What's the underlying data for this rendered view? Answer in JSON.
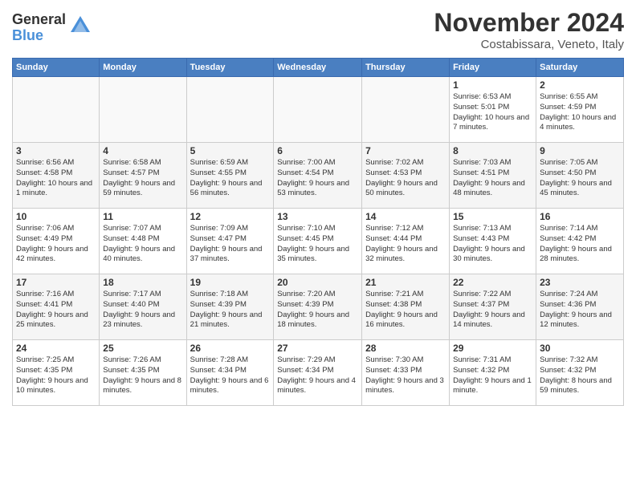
{
  "header": {
    "logo": {
      "general": "General",
      "blue": "Blue"
    },
    "title": "November 2024",
    "subtitle": "Costabissara, Veneto, Italy"
  },
  "calendar": {
    "days_of_week": [
      "Sunday",
      "Monday",
      "Tuesday",
      "Wednesday",
      "Thursday",
      "Friday",
      "Saturday"
    ],
    "weeks": [
      [
        {
          "day": "",
          "info": ""
        },
        {
          "day": "",
          "info": ""
        },
        {
          "day": "",
          "info": ""
        },
        {
          "day": "",
          "info": ""
        },
        {
          "day": "",
          "info": ""
        },
        {
          "day": "1",
          "info": "Sunrise: 6:53 AM\nSunset: 5:01 PM\nDaylight: 10 hours and 7 minutes."
        },
        {
          "day": "2",
          "info": "Sunrise: 6:55 AM\nSunset: 4:59 PM\nDaylight: 10 hours and 4 minutes."
        }
      ],
      [
        {
          "day": "3",
          "info": "Sunrise: 6:56 AM\nSunset: 4:58 PM\nDaylight: 10 hours and 1 minute."
        },
        {
          "day": "4",
          "info": "Sunrise: 6:58 AM\nSunset: 4:57 PM\nDaylight: 9 hours and 59 minutes."
        },
        {
          "day": "5",
          "info": "Sunrise: 6:59 AM\nSunset: 4:55 PM\nDaylight: 9 hours and 56 minutes."
        },
        {
          "day": "6",
          "info": "Sunrise: 7:00 AM\nSunset: 4:54 PM\nDaylight: 9 hours and 53 minutes."
        },
        {
          "day": "7",
          "info": "Sunrise: 7:02 AM\nSunset: 4:53 PM\nDaylight: 9 hours and 50 minutes."
        },
        {
          "day": "8",
          "info": "Sunrise: 7:03 AM\nSunset: 4:51 PM\nDaylight: 9 hours and 48 minutes."
        },
        {
          "day": "9",
          "info": "Sunrise: 7:05 AM\nSunset: 4:50 PM\nDaylight: 9 hours and 45 minutes."
        }
      ],
      [
        {
          "day": "10",
          "info": "Sunrise: 7:06 AM\nSunset: 4:49 PM\nDaylight: 9 hours and 42 minutes."
        },
        {
          "day": "11",
          "info": "Sunrise: 7:07 AM\nSunset: 4:48 PM\nDaylight: 9 hours and 40 minutes."
        },
        {
          "day": "12",
          "info": "Sunrise: 7:09 AM\nSunset: 4:47 PM\nDaylight: 9 hours and 37 minutes."
        },
        {
          "day": "13",
          "info": "Sunrise: 7:10 AM\nSunset: 4:45 PM\nDaylight: 9 hours and 35 minutes."
        },
        {
          "day": "14",
          "info": "Sunrise: 7:12 AM\nSunset: 4:44 PM\nDaylight: 9 hours and 32 minutes."
        },
        {
          "day": "15",
          "info": "Sunrise: 7:13 AM\nSunset: 4:43 PM\nDaylight: 9 hours and 30 minutes."
        },
        {
          "day": "16",
          "info": "Sunrise: 7:14 AM\nSunset: 4:42 PM\nDaylight: 9 hours and 28 minutes."
        }
      ],
      [
        {
          "day": "17",
          "info": "Sunrise: 7:16 AM\nSunset: 4:41 PM\nDaylight: 9 hours and 25 minutes."
        },
        {
          "day": "18",
          "info": "Sunrise: 7:17 AM\nSunset: 4:40 PM\nDaylight: 9 hours and 23 minutes."
        },
        {
          "day": "19",
          "info": "Sunrise: 7:18 AM\nSunset: 4:39 PM\nDaylight: 9 hours and 21 minutes."
        },
        {
          "day": "20",
          "info": "Sunrise: 7:20 AM\nSunset: 4:39 PM\nDaylight: 9 hours and 18 minutes."
        },
        {
          "day": "21",
          "info": "Sunrise: 7:21 AM\nSunset: 4:38 PM\nDaylight: 9 hours and 16 minutes."
        },
        {
          "day": "22",
          "info": "Sunrise: 7:22 AM\nSunset: 4:37 PM\nDaylight: 9 hours and 14 minutes."
        },
        {
          "day": "23",
          "info": "Sunrise: 7:24 AM\nSunset: 4:36 PM\nDaylight: 9 hours and 12 minutes."
        }
      ],
      [
        {
          "day": "24",
          "info": "Sunrise: 7:25 AM\nSunset: 4:35 PM\nDaylight: 9 hours and 10 minutes."
        },
        {
          "day": "25",
          "info": "Sunrise: 7:26 AM\nSunset: 4:35 PM\nDaylight: 9 hours and 8 minutes."
        },
        {
          "day": "26",
          "info": "Sunrise: 7:28 AM\nSunset: 4:34 PM\nDaylight: 9 hours and 6 minutes."
        },
        {
          "day": "27",
          "info": "Sunrise: 7:29 AM\nSunset: 4:34 PM\nDaylight: 9 hours and 4 minutes."
        },
        {
          "day": "28",
          "info": "Sunrise: 7:30 AM\nSunset: 4:33 PM\nDaylight: 9 hours and 3 minutes."
        },
        {
          "day": "29",
          "info": "Sunrise: 7:31 AM\nSunset: 4:32 PM\nDaylight: 9 hours and 1 minute."
        },
        {
          "day": "30",
          "info": "Sunrise: 7:32 AM\nSunset: 4:32 PM\nDaylight: 8 hours and 59 minutes."
        }
      ]
    ]
  }
}
